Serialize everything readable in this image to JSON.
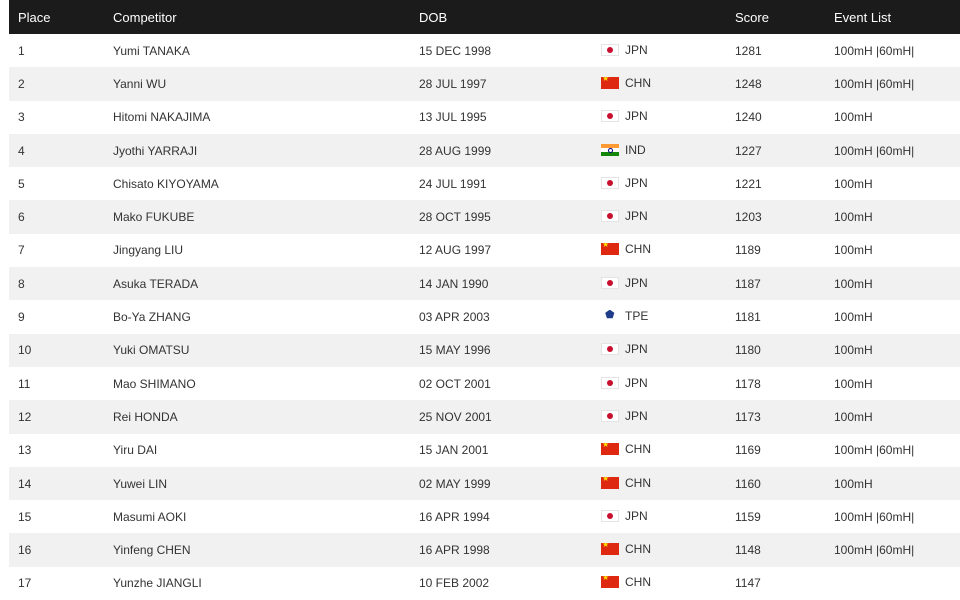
{
  "columns": {
    "place": "Place",
    "competitor": "Competitor",
    "dob": "DOB",
    "country": "",
    "score": "Score",
    "events": "Event List"
  },
  "rows": [
    {
      "place": "1",
      "competitor": "Yumi TANAKA",
      "dob": "15 DEC 1998",
      "flag": "jpn",
      "country": "JPN",
      "score": "1281",
      "events": "100mH |60mH|"
    },
    {
      "place": "2",
      "competitor": "Yanni WU",
      "dob": "28 JUL 1997",
      "flag": "chn",
      "country": "CHN",
      "score": "1248",
      "events": "100mH |60mH|"
    },
    {
      "place": "3",
      "competitor": "Hitomi NAKAJIMA",
      "dob": "13 JUL 1995",
      "flag": "jpn",
      "country": "JPN",
      "score": "1240",
      "events": "100mH"
    },
    {
      "place": "4",
      "competitor": "Jyothi YARRAJI",
      "dob": "28 AUG 1999",
      "flag": "ind",
      "country": "IND",
      "score": "1227",
      "events": "100mH |60mH|"
    },
    {
      "place": "5",
      "competitor": "Chisato KIYOYAMA",
      "dob": "24 JUL 1991",
      "flag": "jpn",
      "country": "JPN",
      "score": "1221",
      "events": "100mH"
    },
    {
      "place": "6",
      "competitor": "Mako FUKUBE",
      "dob": "28 OCT 1995",
      "flag": "jpn",
      "country": "JPN",
      "score": "1203",
      "events": "100mH"
    },
    {
      "place": "7",
      "competitor": "Jingyang LIU",
      "dob": "12 AUG 1997",
      "flag": "chn",
      "country": "CHN",
      "score": "1189",
      "events": "100mH"
    },
    {
      "place": "8",
      "competitor": "Asuka TERADA",
      "dob": "14 JAN 1990",
      "flag": "jpn",
      "country": "JPN",
      "score": "1187",
      "events": "100mH"
    },
    {
      "place": "9",
      "competitor": "Bo-Ya ZHANG",
      "dob": "03 APR 2003",
      "flag": "tpe",
      "country": "TPE",
      "score": "1181",
      "events": "100mH"
    },
    {
      "place": "10",
      "competitor": "Yuki OMATSU",
      "dob": "15 MAY 1996",
      "flag": "jpn",
      "country": "JPN",
      "score": "1180",
      "events": "100mH"
    },
    {
      "place": "11",
      "competitor": "Mao SHIMANO",
      "dob": "02 OCT 2001",
      "flag": "jpn",
      "country": "JPN",
      "score": "1178",
      "events": "100mH"
    },
    {
      "place": "12",
      "competitor": "Rei HONDA",
      "dob": "25 NOV 2001",
      "flag": "jpn",
      "country": "JPN",
      "score": "1173",
      "events": "100mH"
    },
    {
      "place": "13",
      "competitor": "Yiru DAI",
      "dob": "15 JAN 2001",
      "flag": "chn",
      "country": "CHN",
      "score": "1169",
      "events": "100mH |60mH|"
    },
    {
      "place": "14",
      "competitor": "Yuwei LIN",
      "dob": "02 MAY 1999",
      "flag": "chn",
      "country": "CHN",
      "score": "1160",
      "events": "100mH"
    },
    {
      "place": "15",
      "competitor": "Masumi AOKI",
      "dob": "16 APR 1994",
      "flag": "jpn",
      "country": "JPN",
      "score": "1159",
      "events": "100mH |60mH|"
    },
    {
      "place": "16",
      "competitor": "Yinfeng CHEN",
      "dob": "16 APR 1998",
      "flag": "chn",
      "country": "CHN",
      "score": "1148",
      "events": "100mH |60mH|"
    },
    {
      "place": "17",
      "competitor": "Yunzhe JIANGLI",
      "dob": "10 FEB 2002",
      "flag": "chn",
      "country": "CHN",
      "score": "1147",
      "events": ""
    }
  ],
  "colors": {
    "header_bg": "#1b1b1b",
    "header_text": "#ffffff",
    "row_alt_bg": "#f1f1f1",
    "text": "#333333"
  }
}
